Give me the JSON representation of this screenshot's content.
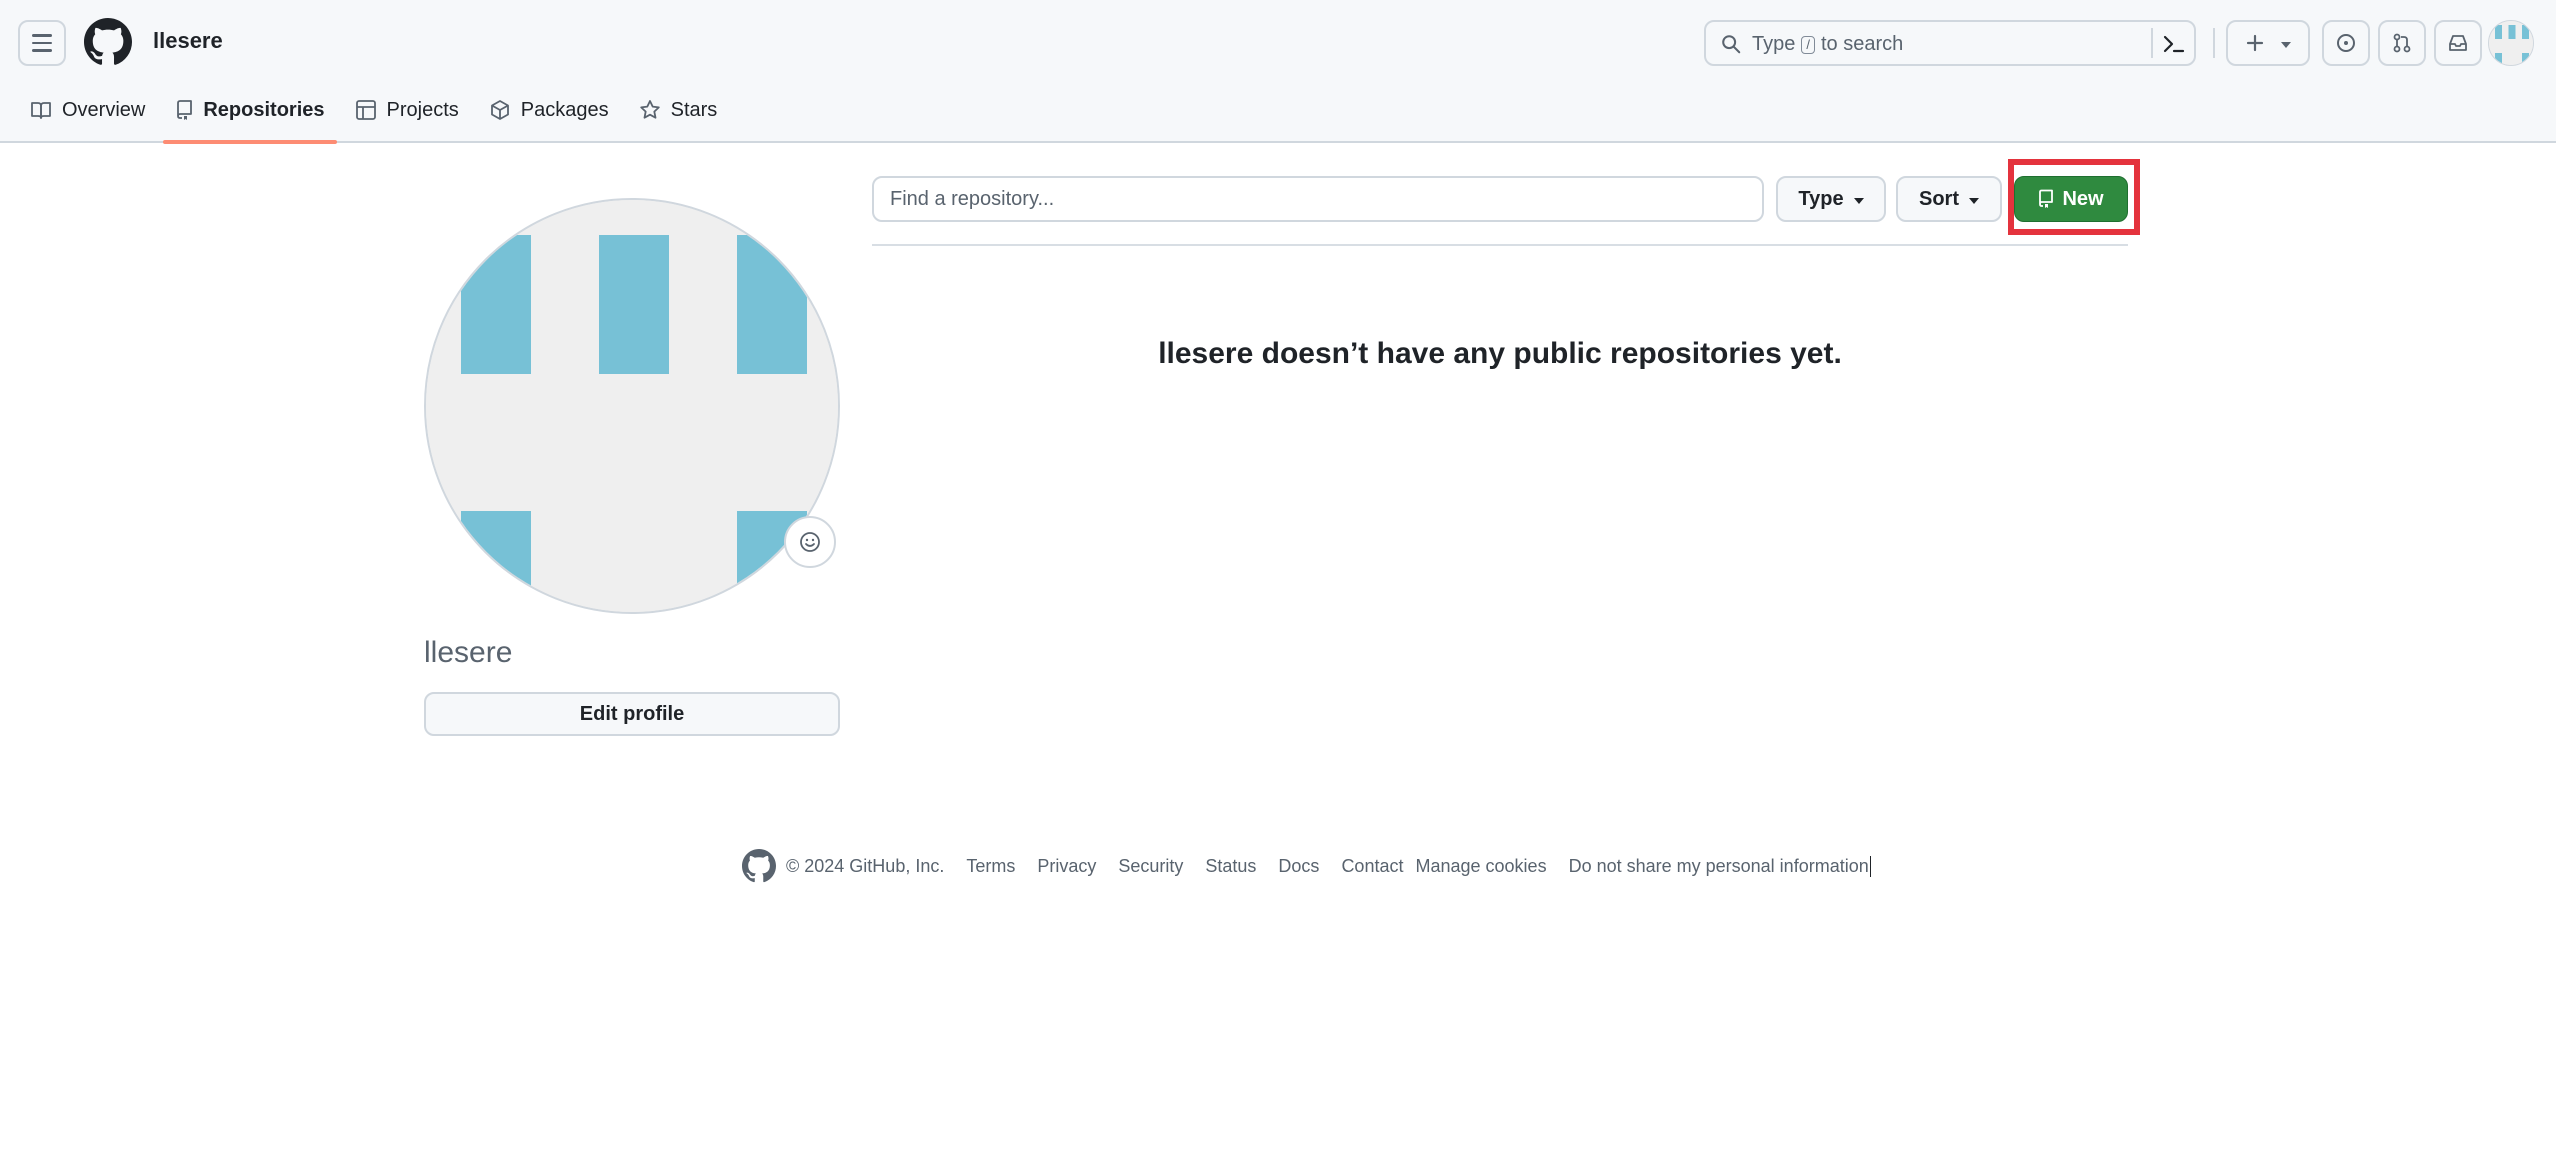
{
  "header": {
    "username": "llesere",
    "search": {
      "prefix": "Type",
      "key": "/",
      "suffix": "to search"
    }
  },
  "tabs": [
    {
      "label": "Overview",
      "active": false
    },
    {
      "label": "Repositories",
      "active": true
    },
    {
      "label": "Projects",
      "active": false
    },
    {
      "label": "Packages",
      "active": false
    },
    {
      "label": "Stars",
      "active": false
    }
  ],
  "profile": {
    "name": "llesere",
    "edit_label": "Edit profile"
  },
  "repos": {
    "filter_placeholder": "Find a repository...",
    "type_label": "Type",
    "sort_label": "Sort",
    "new_label": "New",
    "blank_message": "llesere doesn’t have any public repositories yet."
  },
  "footer": {
    "copyright": "© 2024 GitHub, Inc.",
    "links": [
      "Terms",
      "Privacy",
      "Security",
      "Status",
      "Docs",
      "Contact",
      "Manage cookies",
      "Do not share my personal information"
    ]
  },
  "colors": {
    "accent_tab": "#fd8c73",
    "new_button": "#2f8a3f",
    "highlight": "#e4333d",
    "identicon": "#77c1d6"
  }
}
